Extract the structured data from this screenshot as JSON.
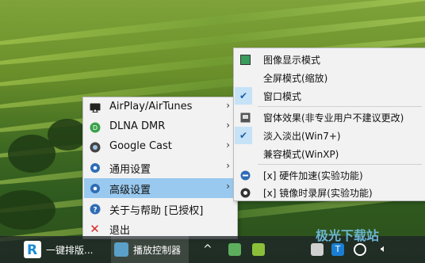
{
  "context_menu": {
    "items": [
      {
        "label": "AirPlay/AirTunes",
        "icon": "airplay-icon",
        "has_submenu": true
      },
      {
        "label": "DLNA DMR",
        "icon": "dlna-icon",
        "has_submenu": true
      },
      {
        "label": "Google Cast",
        "icon": "cast-icon",
        "has_submenu": true
      },
      {
        "label": "通用设置",
        "icon": "gear-icon",
        "has_submenu": true
      },
      {
        "label": "高级设置",
        "icon": "gear-icon",
        "has_submenu": true,
        "highlighted": true
      },
      {
        "label": "关于与帮助 [已授权]",
        "icon": "help-icon",
        "has_submenu": false
      },
      {
        "label": "退出",
        "icon": "close-icon",
        "has_submenu": false
      }
    ]
  },
  "advanced_submenu": {
    "items": [
      {
        "label": "图像显示模式",
        "checked": false
      },
      {
        "label": "全屏模式(缩放)",
        "checked": false
      },
      {
        "label": "窗口模式",
        "checked": true
      },
      {
        "label": "窗体效果(非专业用户不建议更改)",
        "checked": false
      },
      {
        "label": "淡入淡出(Win7+)",
        "checked": true
      },
      {
        "label": "兼容模式(WinXP)",
        "checked": false
      },
      {
        "label": "[x] 硬件加速(实验功能)",
        "checked": false
      },
      {
        "label": "[x] 镜像时录屏(实验功能)",
        "checked": false
      }
    ]
  },
  "taskbar": {
    "app1_label": "一键排版...",
    "app2_label": "播放控制器",
    "tray_chevron": "^",
    "watermark": "极光下载站"
  },
  "colors": {
    "highlight": "#99c9ef",
    "menu_bg": "#f2f2f2",
    "check_col": "#c5e2f7"
  }
}
